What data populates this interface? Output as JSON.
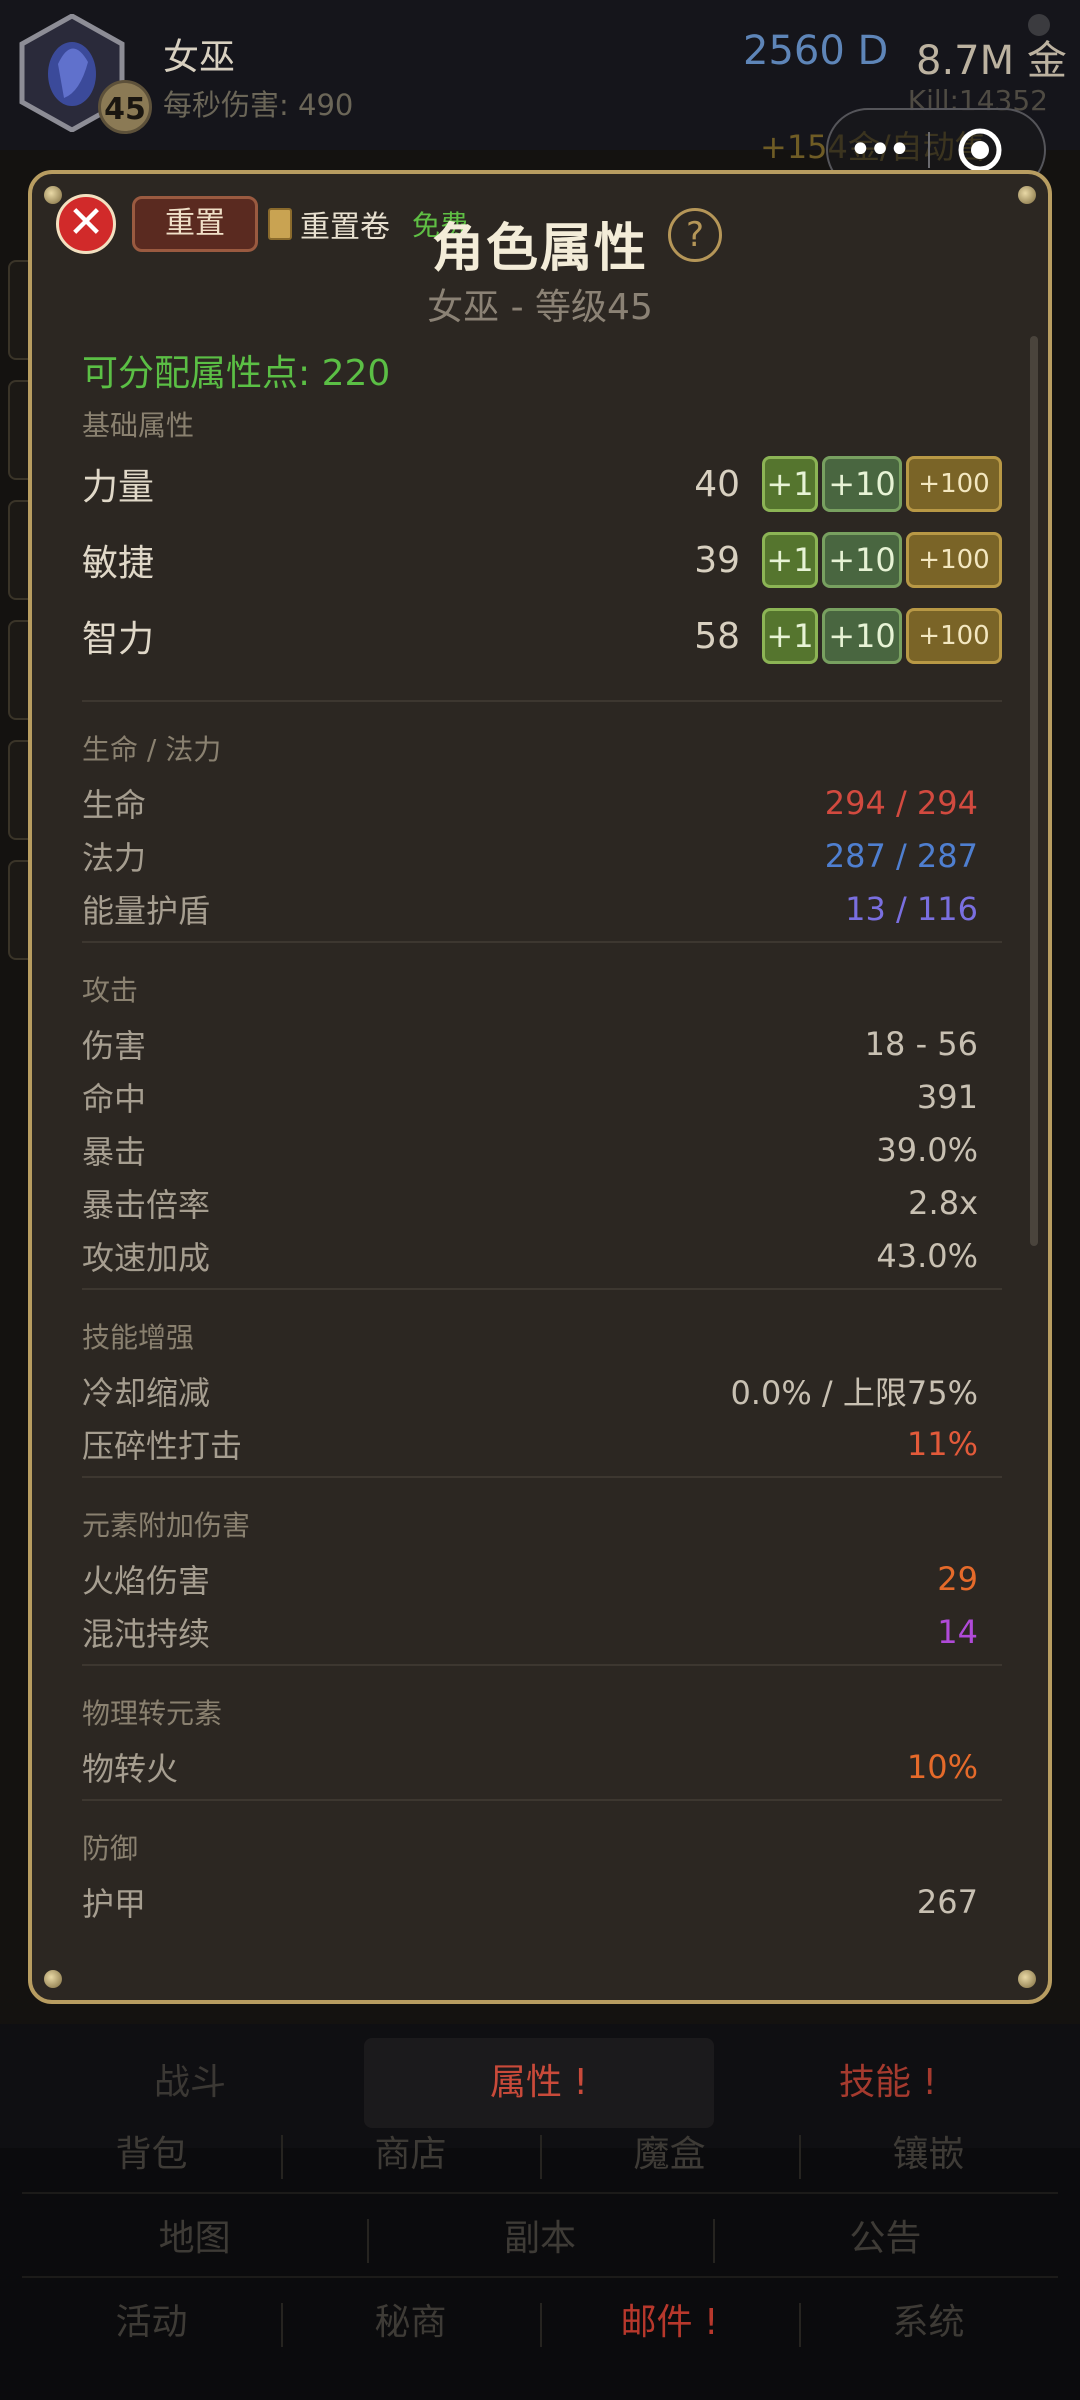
{
  "header": {
    "char_name": "女巫",
    "level": "45",
    "dps": "每秒伤害: 490",
    "diamonds": "2560 D",
    "gold": "8.7M 金",
    "kills": "Kill:14352",
    "gold_rate": "+154金/自动售"
  },
  "modal": {
    "title": "角色属性",
    "subtitle": "女巫 - 等级45",
    "reset_label": "重置",
    "scroll_label": "重置卷",
    "free_label": "免费",
    "help_label": "?",
    "close_label": "✕",
    "points_label": "可分配属性点: 220",
    "sections": {
      "base": "基础属性",
      "life_mana": "生命 / 法力",
      "attack": "攻击",
      "skill": "技能增强",
      "element": "元素附加伤害",
      "convert": "物理转元素",
      "defense": "防御"
    },
    "buttons": {
      "plus1": "+1",
      "plus10": "+10",
      "plus100": "+100"
    },
    "primary": [
      {
        "name": "力量",
        "value": "40"
      },
      {
        "name": "敏捷",
        "value": "39"
      },
      {
        "name": "智力",
        "value": "58"
      }
    ],
    "life_mana": [
      {
        "name": "生命",
        "value": "294 / 294",
        "color": "#d24a3f"
      },
      {
        "name": "法力",
        "value": "287 / 287",
        "color": "#4f7fd0"
      },
      {
        "name": "能量护盾",
        "value": "13 / 116",
        "color": "#7a6fe0"
      }
    ],
    "attack": [
      {
        "name": "伤害",
        "value": "18 - 56"
      },
      {
        "name": "命中",
        "value": "391"
      },
      {
        "name": "暴击",
        "value": "39.0%"
      },
      {
        "name": "暴击倍率",
        "value": "2.8x"
      },
      {
        "name": "攻速加成",
        "value": "43.0%"
      }
    ],
    "skill": [
      {
        "name": "冷却缩减",
        "value": "0.0% / 上限75%",
        "color": "#c8c0b2"
      },
      {
        "name": "压碎性打击",
        "value": "11%",
        "color": "#e35a3a"
      }
    ],
    "element": [
      {
        "name": "火焰伤害",
        "value": "29",
        "color": "#e56a2a"
      },
      {
        "name": "混沌持续",
        "value": "14",
        "color": "#b04ad8"
      }
    ],
    "convert": [
      {
        "name": "物转火",
        "value": "10%",
        "color": "#e56a2a"
      }
    ],
    "defense": [
      {
        "name": "护甲",
        "value": "267"
      }
    ]
  },
  "tabs": [
    {
      "label": "战斗",
      "color": "#3b3834"
    },
    {
      "label": "属性 !",
      "color": "#c94a3a"
    },
    {
      "label": "技能 !",
      "color": "#a53a2e"
    }
  ],
  "menu": [
    [
      {
        "label": "背包"
      },
      {
        "label": "商店"
      },
      {
        "label": "魔盒"
      },
      {
        "label": "镶嵌"
      }
    ],
    [
      {
        "label": "地图"
      },
      {
        "label": "副本"
      },
      {
        "label": "公告"
      }
    ],
    [
      {
        "label": "活动"
      },
      {
        "label": "秘商"
      },
      {
        "label": "邮件 !",
        "color": "#b8382c"
      },
      {
        "label": "系统"
      }
    ]
  ]
}
